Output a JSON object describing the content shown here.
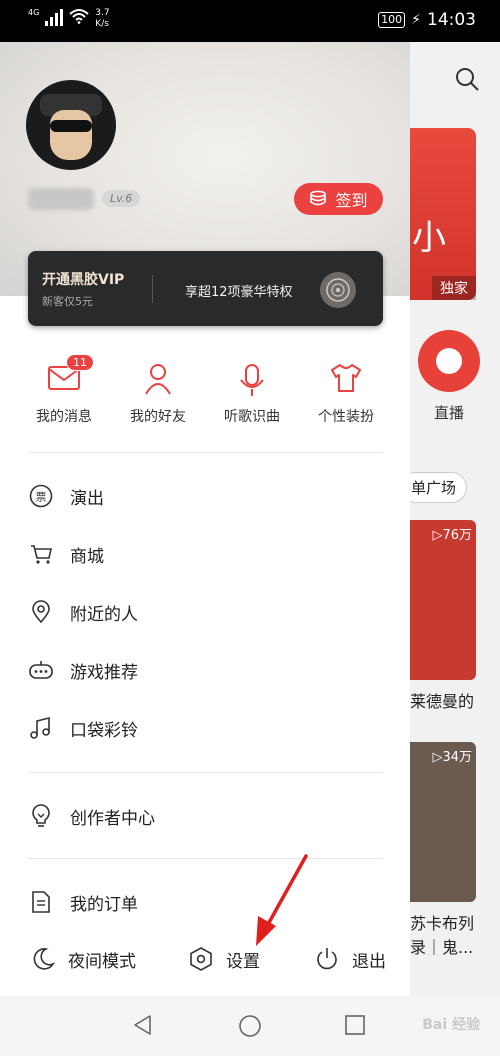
{
  "status_bar": {
    "signal": "4G",
    "speed_value": "3.7",
    "speed_unit": "K/s",
    "battery": "100",
    "time": "14:03"
  },
  "background_app": {
    "banner_char": "小",
    "banner_tag": "独家",
    "live_label": "直播",
    "square_label": "单广场",
    "card1_count": "▷76万",
    "card1_text": "莱德曼的",
    "card2_count": "▷34万",
    "card2_text_1": "苏卡布列",
    "card2_text_2": "录｜鬼..."
  },
  "profile": {
    "level": "Lv.6",
    "checkin_label": "签到"
  },
  "vip": {
    "title": "开通黑胶VIP",
    "subtitle": "新客仅5元",
    "promo": "享超12项豪华特权"
  },
  "quick_actions": [
    {
      "label": "我的消息",
      "icon": "mail-icon",
      "badge": "11"
    },
    {
      "label": "我的好友",
      "icon": "person-icon"
    },
    {
      "label": "听歌识曲",
      "icon": "mic-icon"
    },
    {
      "label": "个性装扮",
      "icon": "tshirt-icon"
    }
  ],
  "menu": [
    {
      "label": "演出",
      "icon": "ticket-icon"
    },
    {
      "label": "商城",
      "icon": "cart-icon"
    },
    {
      "label": "附近的人",
      "icon": "location-icon"
    },
    {
      "label": "游戏推荐",
      "icon": "gamepad-icon"
    },
    {
      "label": "口袋彩铃",
      "icon": "music-note-icon"
    },
    {
      "label": "创作者中心",
      "icon": "lightbulb-icon"
    },
    {
      "label": "我的订单",
      "icon": "document-icon"
    }
  ],
  "bottom": {
    "night_mode": "夜间模式",
    "settings": "设置",
    "logout": "退出"
  },
  "colors": {
    "accent": "#ec4141",
    "vip_bg": "#2a2a2a"
  },
  "watermark": "Bai 经验"
}
